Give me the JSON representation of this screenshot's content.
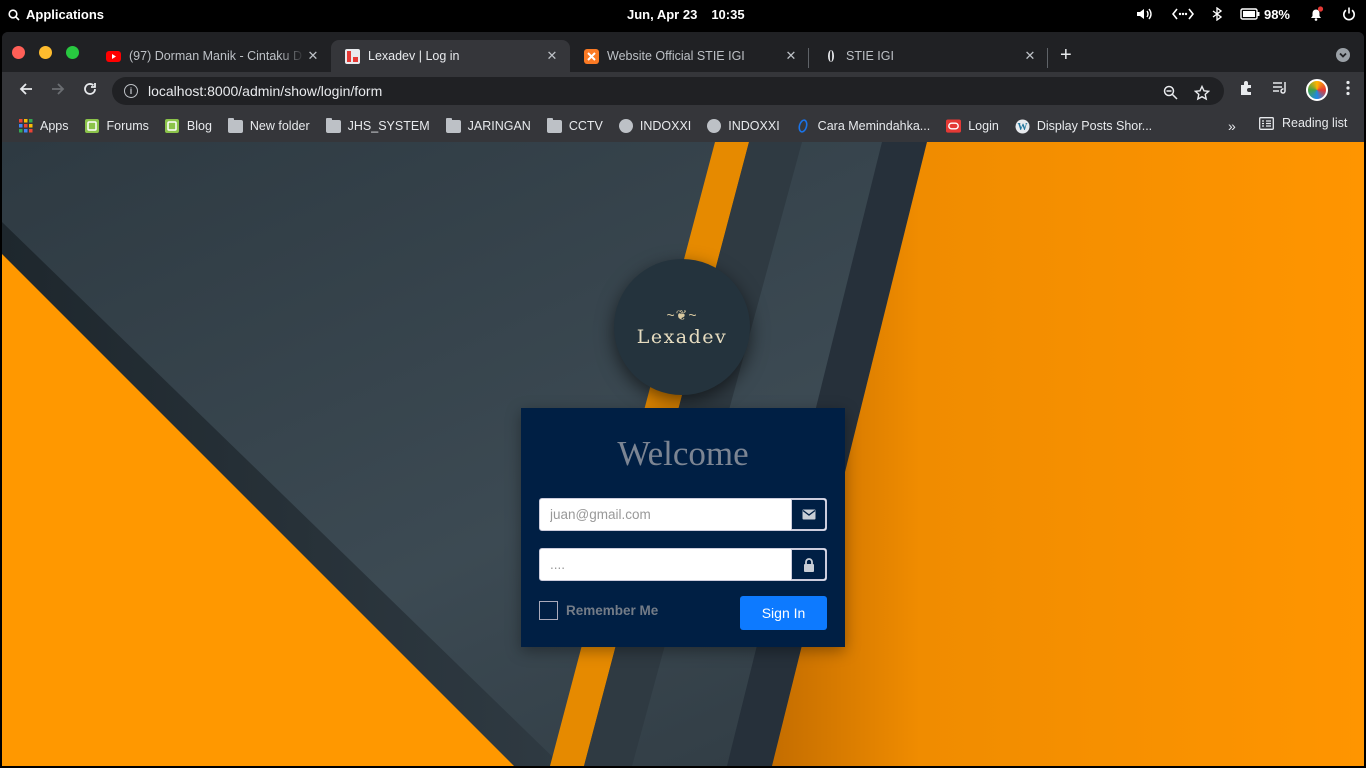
{
  "system_bar": {
    "apps_label": "Applications",
    "date": "Jun, Apr 23",
    "time": "10:35",
    "battery": "98%"
  },
  "browser": {
    "tabs": [
      {
        "title": "(97) Dorman Manik - Cintaku D",
        "favicon": "youtube-icon",
        "active": false
      },
      {
        "title": "Lexadev | Log in",
        "favicon": "lexadev-icon",
        "active": true
      },
      {
        "title": "Website Official STIE IGI",
        "favicon": "xampp-icon",
        "active": false
      },
      {
        "title": "STIE IGI",
        "favicon": "loading-icon",
        "active": false
      }
    ],
    "url": "localhost:8000/admin/show/login/form",
    "bookmarks": [
      {
        "label": "Apps",
        "icon": "apps-grid-icon"
      },
      {
        "label": "Forums",
        "icon": "mint-icon"
      },
      {
        "label": "Blog",
        "icon": "mint-icon"
      },
      {
        "label": "New folder",
        "icon": "folder-icon"
      },
      {
        "label": "JHS_SYSTEM",
        "icon": "folder-icon"
      },
      {
        "label": "JARINGAN",
        "icon": "folder-icon"
      },
      {
        "label": "CCTV",
        "icon": "folder-icon"
      },
      {
        "label": "INDOXXI",
        "icon": "globe-icon"
      },
      {
        "label": "INDOXXI",
        "icon": "globe-icon"
      },
      {
        "label": "Cara Memindahka...",
        "icon": "opera-icon"
      },
      {
        "label": "Login",
        "icon": "oracle-icon"
      },
      {
        "label": "Display Posts Shor...",
        "icon": "wordpress-icon"
      }
    ],
    "reading_list": "Reading list"
  },
  "login": {
    "logo_text": "Lexadev",
    "logo_ornament": "~❦~",
    "title": "Welcome",
    "email_placeholder": "juan@gmail.com",
    "password_placeholder": "....",
    "remember_label": "Remember Me",
    "signin_label": "Sign In"
  },
  "colors": {
    "accent_orange": "#ff9800",
    "card_bg": "#001f44",
    "button_blue": "#0d7aff"
  }
}
